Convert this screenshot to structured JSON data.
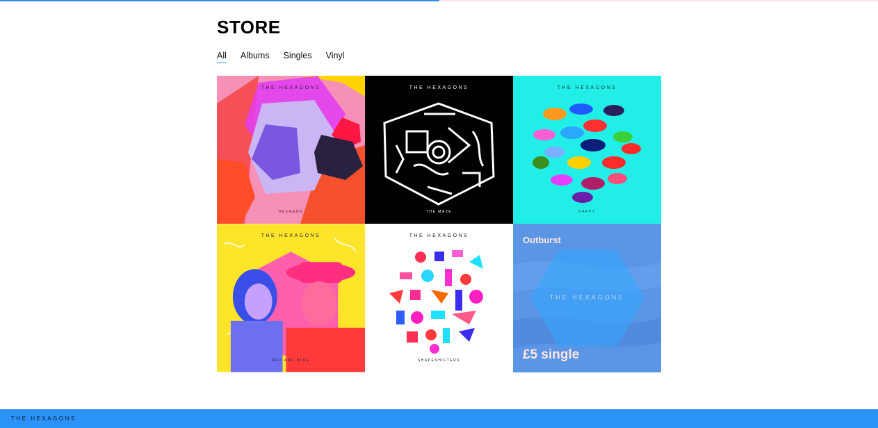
{
  "page": {
    "title": "STORE",
    "progress": 0.5
  },
  "tabs": [
    {
      "label": "All",
      "active": true
    },
    {
      "label": "Albums",
      "active": false
    },
    {
      "label": "Singles",
      "active": false
    },
    {
      "label": "Vinyl",
      "active": false
    }
  ],
  "albums": [
    {
      "band": "THE HEXAGONS",
      "name": "HEXAGON",
      "bg": "#f48ab0"
    },
    {
      "band": "THE HEXAGONS",
      "name": "THE MAZE",
      "bg": "#000000"
    },
    {
      "band": "THE HEXAGONS",
      "name": "HAPPY",
      "bg": "#22eee8"
    },
    {
      "band": "THE HEXAGONS",
      "name": "RED AND BLUE",
      "bg": "#ffe52a"
    },
    {
      "band": "THE HEXAGONS",
      "name": "SHAPESHIFTERS",
      "bg": "#ffffff"
    },
    {
      "band": "THE HEXAGONS",
      "name": "",
      "bg": "#5b95e6",
      "overlay": {
        "title": "Outburst",
        "price": "£5 single"
      }
    }
  ],
  "footer": {
    "logo": "THE HEXAGONS",
    "bg": "#2b93f7"
  }
}
